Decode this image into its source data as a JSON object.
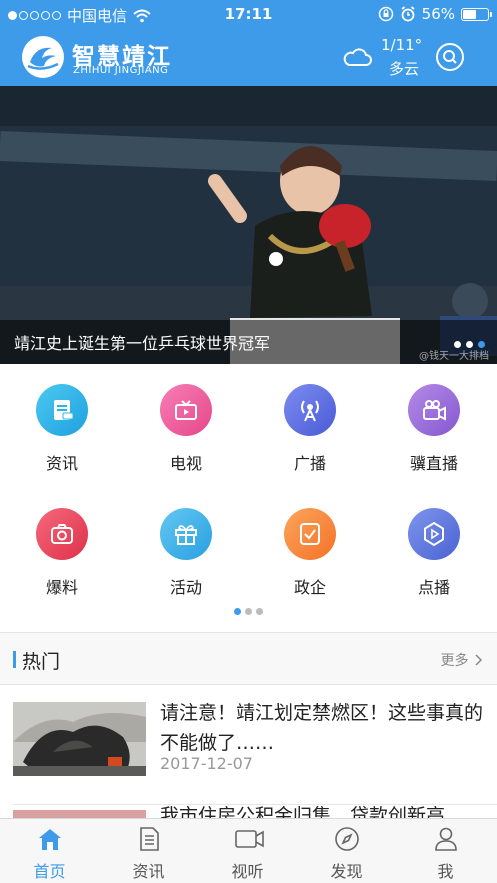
{
  "status_bar": {
    "carrier": "中国电信",
    "time": "17:11",
    "battery": "56%",
    "battery_level": 0.56,
    "signal_bars": 1
  },
  "header": {
    "logo_cn": "智慧靖江",
    "logo_en": "ZHIHUI JINGJIANG",
    "weather_temp": "1/11°",
    "weather_desc": "多云",
    "weather_icon": "cloud-icon",
    "search_icon": "search-icon"
  },
  "banner": {
    "caption": "靖江史上诞生第一位乒乓球世界冠军",
    "watermark": "@钱天一大排档",
    "slide_count": 3,
    "active_slide": 3
  },
  "categories": [
    {
      "label": "资讯",
      "icon": "news-icon",
      "color": "#29b6e6"
    },
    {
      "label": "电视",
      "icon": "tv-icon",
      "color": "#ec5b9b"
    },
    {
      "label": "广播",
      "icon": "broadcast-icon",
      "color": "#5c6fe0"
    },
    {
      "label": "骥直播",
      "icon": "video-camera-icon",
      "color": "#9b6bd8"
    },
    {
      "label": "爆料",
      "icon": "camera-icon",
      "color": "#ec4b61"
    },
    {
      "label": "活动",
      "icon": "gift-icon",
      "color": "#3fb2e8"
    },
    {
      "label": "政企",
      "icon": "checkbox-icon",
      "color": "#f7893d"
    },
    {
      "label": "点播",
      "icon": "play-icon",
      "color": "#5774db"
    }
  ],
  "grid_pages": {
    "count": 3,
    "active": 1
  },
  "hot": {
    "title": "热门",
    "more": "更多"
  },
  "news": [
    {
      "title": "请注意！靖江划定禁燃区！这些事真的不能做了……",
      "date": "2017-12-07"
    },
    {
      "title": "我市住房公积金归集、贷款创新高"
    }
  ],
  "tabs": [
    {
      "label": "首页",
      "icon": "home-icon",
      "active": true
    },
    {
      "label": "资讯",
      "icon": "document-icon",
      "active": false
    },
    {
      "label": "视听",
      "icon": "video-icon",
      "active": false
    },
    {
      "label": "发现",
      "icon": "compass-icon",
      "active": false
    },
    {
      "label": "我",
      "icon": "user-icon",
      "active": false
    }
  ],
  "colors": {
    "brand_blue": "#3d9be9",
    "tab_inactive": "#555555"
  }
}
